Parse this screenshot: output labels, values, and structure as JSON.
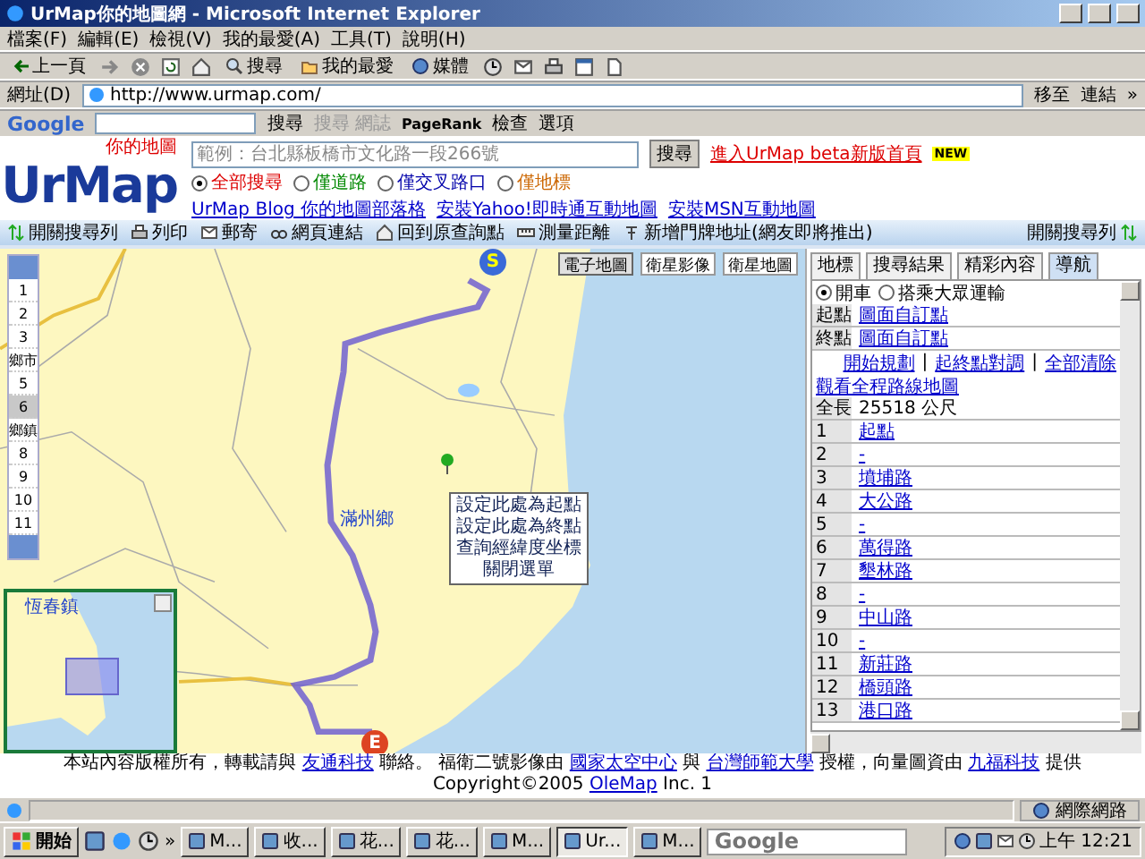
{
  "window": {
    "title": "UrMap你的地圖網 - Microsoft Internet Explorer"
  },
  "menu": [
    "檔案(F)",
    "編輯(E)",
    "檢視(V)",
    "我的最愛(A)",
    "工具(T)",
    "說明(H)"
  ],
  "toolbar": [
    {
      "kind": "back",
      "label": "上一頁"
    },
    {
      "kind": "forward"
    },
    {
      "kind": "stop"
    },
    {
      "kind": "refresh"
    },
    {
      "kind": "home"
    },
    {
      "kind": "search",
      "label": "搜尋"
    },
    {
      "kind": "favorites",
      "label": "我的最愛"
    },
    {
      "kind": "media",
      "label": "媒體"
    },
    {
      "kind": "history"
    },
    {
      "kind": "mail"
    },
    {
      "kind": "print"
    },
    {
      "kind": "edit"
    },
    {
      "kind": "document"
    }
  ],
  "address": {
    "label": "網址(D)",
    "url": "http://www.urmap.com/",
    "go": "移至",
    "links": "連結",
    "more": "»"
  },
  "google_bar": {
    "logo": "Google",
    "search": "搜尋",
    "blog_search": {
      "label": "搜尋 網誌",
      "disabled": true
    },
    "pagerank": "PageRank",
    "check": "檢查",
    "options": "選項"
  },
  "header": {
    "logo": "UrMap",
    "tagline": "你的地圖",
    "search": {
      "placeholder": "範例：台北縣板橋市文化路一段266號",
      "button": "搜尋"
    },
    "beta_link": "進入UrMap beta新版首頁",
    "new_badge": "NEW",
    "scopes": [
      {
        "label": "全部搜尋",
        "selected": true
      },
      {
        "label": "僅道路",
        "selected": false
      },
      {
        "label": "僅交叉路口",
        "selected": false
      },
      {
        "label": "僅地標",
        "selected": false
      }
    ],
    "links": [
      "UrMap Blog 你的地圖部落格",
      "安裝Yahoo!即時通互動地圖",
      "安裝MSN互動地圖"
    ]
  },
  "tool_strip": [
    {
      "kind": "toggle",
      "label": "開關搜尋列"
    },
    {
      "kind": "print",
      "label": "列印"
    },
    {
      "kind": "mail",
      "label": "郵寄"
    },
    {
      "kind": "link",
      "label": "網頁連結"
    },
    {
      "kind": "home",
      "label": "回到原查詢點"
    },
    {
      "kind": "measure",
      "label": "測量距離"
    },
    {
      "kind": "pin",
      "label": "新增門牌地址(網友即將推出)"
    },
    {
      "kind": "toggle",
      "label": "開關搜尋列"
    }
  ],
  "map": {
    "zoom_levels": [
      {
        "label": "1",
        "selected": false
      },
      {
        "label": "2",
        "selected": false
      },
      {
        "label": "3",
        "selected": false
      },
      {
        "label": "鄉市",
        "selected": false
      },
      {
        "label": "5",
        "selected": false
      },
      {
        "label": "6",
        "selected": true
      },
      {
        "label": "鄉鎮",
        "selected": false
      },
      {
        "label": "8",
        "selected": false
      },
      {
        "label": "9",
        "selected": false
      },
      {
        "label": "10",
        "selected": false
      },
      {
        "label": "11",
        "selected": false
      }
    ],
    "map_types": [
      {
        "label": "電子地圖",
        "selected": true
      },
      {
        "label": "衛星影像",
        "selected": false
      },
      {
        "label": "衛星地圖",
        "selected": false
      }
    ],
    "place_label": "滿州鄉",
    "start_marker": "S",
    "end_marker": "E",
    "context_menu": [
      "設定此處為起點",
      "設定此處為終點",
      "查詢經緯度坐標",
      "關閉選單"
    ],
    "overview_label": "恆春鎮"
  },
  "panel": {
    "tabs": [
      {
        "label": "地標",
        "selected": false
      },
      {
        "label": "搜尋結果",
        "selected": false
      },
      {
        "label": "精彩內容",
        "selected": false
      },
      {
        "label": "導航",
        "selected": true
      }
    ],
    "modes": [
      {
        "label": "開車",
        "selected": true
      },
      {
        "label": "搭乘大眾運輸",
        "selected": false
      }
    ],
    "endpoints": [
      {
        "label": "起點",
        "value": "圖面自訂點"
      },
      {
        "label": "終點",
        "value": "圖面自訂點"
      }
    ],
    "actions": [
      "開始規劃",
      "起終點對調",
      "全部清除"
    ],
    "separator": "|",
    "overview_link": "觀看全程路線地圖",
    "total": {
      "label": "全長",
      "value": "25518 公尺"
    },
    "steps": [
      {
        "no": "1",
        "road": "起點"
      },
      {
        "no": "2",
        "road": "-"
      },
      {
        "no": "3",
        "road": "墳埔路"
      },
      {
        "no": "4",
        "road": "大公路"
      },
      {
        "no": "5",
        "road": "-"
      },
      {
        "no": "6",
        "road": "萬得路"
      },
      {
        "no": "7",
        "road": "墾林路"
      },
      {
        "no": "8",
        "road": "-"
      },
      {
        "no": "9",
        "road": "中山路"
      },
      {
        "no": "10",
        "road": "-"
      },
      {
        "no": "11",
        "road": "新莊路"
      },
      {
        "no": "12",
        "road": "橋頭路"
      },
      {
        "no": "13",
        "road": "港口路"
      }
    ]
  },
  "footer": [
    {
      "text": "本站內容版權所有，轉載請與 ",
      "link": false
    },
    {
      "text": "友通科技",
      "link": true
    },
    {
      "text": " 聯絡。 福衛二號影像由 ",
      "link": false
    },
    {
      "text": "國家太空中心",
      "link": true
    },
    {
      "text": " 與 ",
      "link": false
    },
    {
      "text": "台灣師範大學",
      "link": true
    },
    {
      "text": " 授權，向量圖資由 ",
      "link": false
    },
    {
      "text": "九福科技",
      "link": true
    },
    {
      "text": " 提供 Copyright©2005 ",
      "link": false
    },
    {
      "text": "OleMap",
      "link": true
    },
    {
      "text": " Inc. 1",
      "link": false
    }
  ],
  "status_bar": {
    "zone": "網際網路"
  },
  "taskbar": {
    "start": "開始",
    "more": "»",
    "tasks": [
      {
        "label": "M...",
        "selected": false
      },
      {
        "label": "收...",
        "selected": false
      },
      {
        "label": "花...",
        "selected": false
      },
      {
        "label": "花...",
        "selected": false
      },
      {
        "label": "M...",
        "selected": false
      },
      {
        "label": "Ur...",
        "selected": true
      },
      {
        "label": "M...",
        "selected": false
      }
    ],
    "deskbar": {
      "placeholder": "Google"
    },
    "clock": "上午 12:21"
  }
}
